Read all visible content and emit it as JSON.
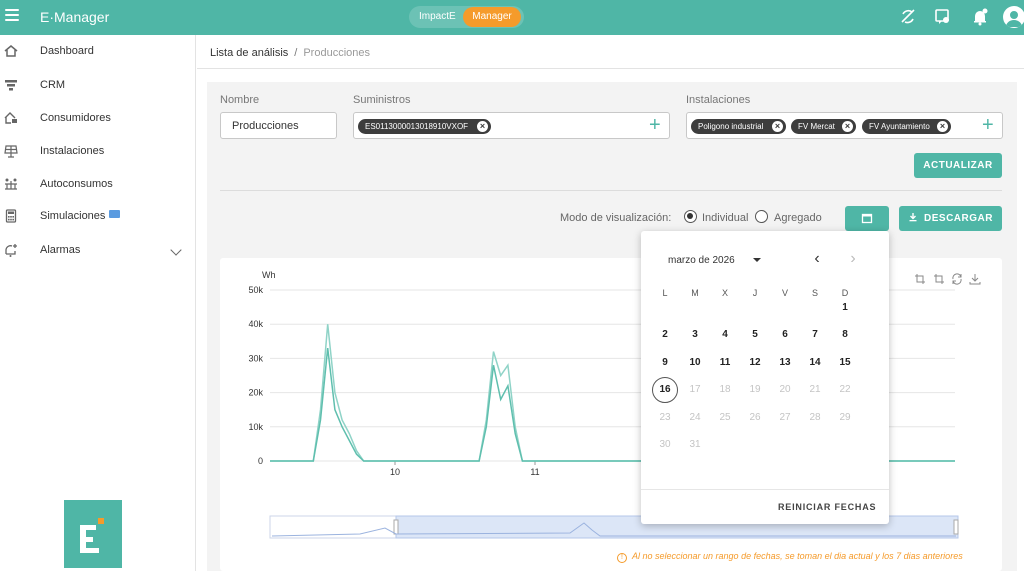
{
  "app": {
    "title": "E·Manager"
  },
  "product_switch": {
    "option1": "ImpactE",
    "option2": "Manager"
  },
  "colors": {
    "primary": "#4fb6a6",
    "accent": "#f59b2b",
    "chip": "#3d3d3d"
  },
  "sidebar": {
    "items": [
      {
        "label": "Dashboard",
        "icon": "home-icon"
      },
      {
        "label": "CRM",
        "icon": "funnel-icon"
      },
      {
        "label": "Consumidores",
        "icon": "house-lock-icon"
      },
      {
        "label": "Instalaciones",
        "icon": "solar-panel-icon"
      },
      {
        "label": "Autoconsumos",
        "icon": "solar-grid-icon"
      },
      {
        "label": "Simulaciones",
        "icon": "calculator-icon",
        "badge": "new-badge-icon"
      },
      {
        "label": "Alarmas",
        "icon": "bell-add-icon"
      }
    ]
  },
  "breadcrumb": {
    "parent": "Lista de análisis",
    "separator": "/",
    "current": "Producciones"
  },
  "form": {
    "name_label": "Nombre",
    "name_value": "Producciones",
    "supplies_label": "Suministros",
    "supplies": [
      "ES0113000013018910VXOF"
    ],
    "installations_label": "Instalaciones",
    "installations": [
      "Poligono industrial",
      "FV Mercat",
      "FV Ayuntamiento"
    ],
    "update_button": "ACTUALIZAR"
  },
  "view_mode": {
    "label": "Modo de visualización:",
    "options": [
      "Individual",
      "Agregado"
    ],
    "selected": "Individual",
    "download_button": "DESCARGAR"
  },
  "chart_data": {
    "type": "line",
    "ylabel": "Wh",
    "ylim": [
      0,
      50000
    ],
    "yticks": [
      "50k",
      "40k",
      "30k",
      "20k",
      "10k",
      "0"
    ],
    "xticks": [
      "10",
      "11"
    ],
    "series": [
      {
        "values": [
          0,
          0,
          0,
          0,
          0,
          0,
          0,
          15000,
          40000,
          20000,
          12000,
          8000,
          3000,
          0,
          0,
          0,
          0,
          0,
          0,
          0,
          0,
          0,
          0,
          0,
          0,
          0,
          0,
          0,
          0,
          0,
          12000,
          32000,
          25000,
          28000,
          10000,
          0,
          0,
          0,
          0,
          0,
          0,
          0,
          0,
          0,
          0,
          0,
          0,
          0,
          0,
          0,
          0,
          0,
          0,
          0,
          0,
          0,
          0,
          0,
          0,
          0,
          0,
          0,
          0,
          0,
          0,
          0,
          0,
          0,
          0,
          0,
          0,
          0,
          0,
          0,
          0,
          0,
          0,
          0,
          0,
          0,
          0,
          0,
          0,
          0,
          0,
          0,
          0,
          0,
          0,
          0,
          0,
          0,
          0,
          0,
          0,
          0
        ]
      },
      {
        "values": [
          0,
          0,
          0,
          0,
          0,
          0,
          0,
          12000,
          33000,
          15000,
          10000,
          6000,
          2000,
          0,
          0,
          0,
          0,
          0,
          0,
          0,
          0,
          0,
          0,
          0,
          0,
          0,
          0,
          0,
          0,
          0,
          10000,
          28000,
          18000,
          22000,
          8000,
          0,
          0,
          0,
          0,
          0,
          0,
          0,
          0,
          0,
          0,
          0,
          0,
          0,
          0,
          0,
          0,
          0,
          0,
          0,
          0,
          0,
          0,
          0,
          0,
          0,
          0,
          0,
          0,
          0,
          0,
          0,
          0,
          0,
          0,
          0,
          0,
          0,
          0,
          0,
          0,
          0,
          0,
          0,
          0,
          0,
          0,
          0,
          0,
          0,
          0,
          0,
          0,
          0,
          0,
          0,
          0,
          0,
          0,
          0,
          0,
          0
        ]
      }
    ]
  },
  "date_note": "Al no seleccionar un rango de fechas, se toman el dia actual y los 7 dias anteriores",
  "calendar": {
    "month_label": "marzo de 2026",
    "weekdays": [
      "L",
      "M",
      "X",
      "J",
      "V",
      "S",
      "D"
    ],
    "today": "16",
    "reset_button": "REINICIAR FECHAS"
  }
}
